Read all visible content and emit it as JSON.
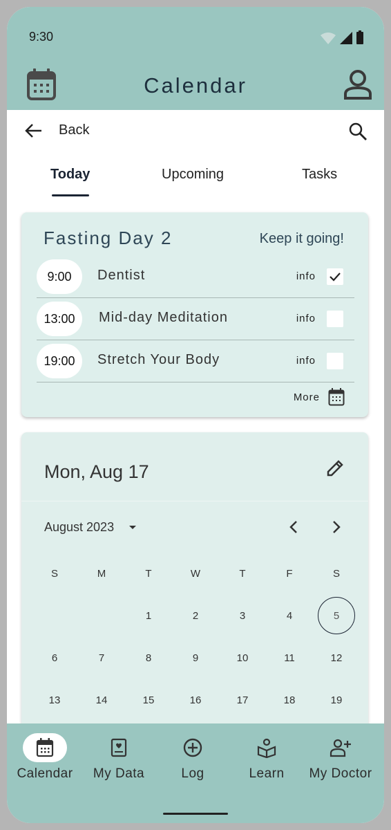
{
  "status": {
    "time": "9:30"
  },
  "appbar": {
    "title": "Calendar"
  },
  "nav": {
    "back_label": "Back"
  },
  "tabs": [
    {
      "label": "Today"
    },
    {
      "label": "Upcoming"
    },
    {
      "label": "Tasks"
    }
  ],
  "fasting": {
    "title": "Fasting Day 2",
    "message": "Keep it going!",
    "events": [
      {
        "time": "9:00",
        "name": "Dentist",
        "info": "info",
        "checked": true
      },
      {
        "time": "13:00",
        "name": "Mid-day Meditation",
        "info": "info",
        "checked": false
      },
      {
        "time": "19:00",
        "name": "Stretch Your Body",
        "info": "info",
        "checked": false
      }
    ],
    "more_label": "More"
  },
  "calendar": {
    "selected_date": "Mon, Aug 17",
    "month_label": "August 2023",
    "weekdays": [
      "S",
      "M",
      "T",
      "W",
      "T",
      "F",
      "S"
    ],
    "rows": [
      [
        "",
        "",
        "1",
        "2",
        "3",
        "4",
        "5"
      ],
      [
        "6",
        "7",
        "8",
        "9",
        "10",
        "11",
        "12"
      ],
      [
        "13",
        "14",
        "15",
        "16",
        "17",
        "18",
        "19"
      ]
    ],
    "highlighted_day": "5"
  },
  "bottom_nav": [
    {
      "label": "Calendar",
      "icon": "calendar-icon",
      "active": true
    },
    {
      "label": "My Data",
      "icon": "my-data-icon",
      "active": false
    },
    {
      "label": "Log",
      "icon": "add-circle-icon",
      "active": false
    },
    {
      "label": "Learn",
      "icon": "learn-icon",
      "active": false
    },
    {
      "label": "My Doctor",
      "icon": "add-person-icon",
      "active": false
    }
  ],
  "colors": {
    "header_bg": "#9ac6c0",
    "card_bg": "#deefec",
    "accent": "#1b2433"
  }
}
